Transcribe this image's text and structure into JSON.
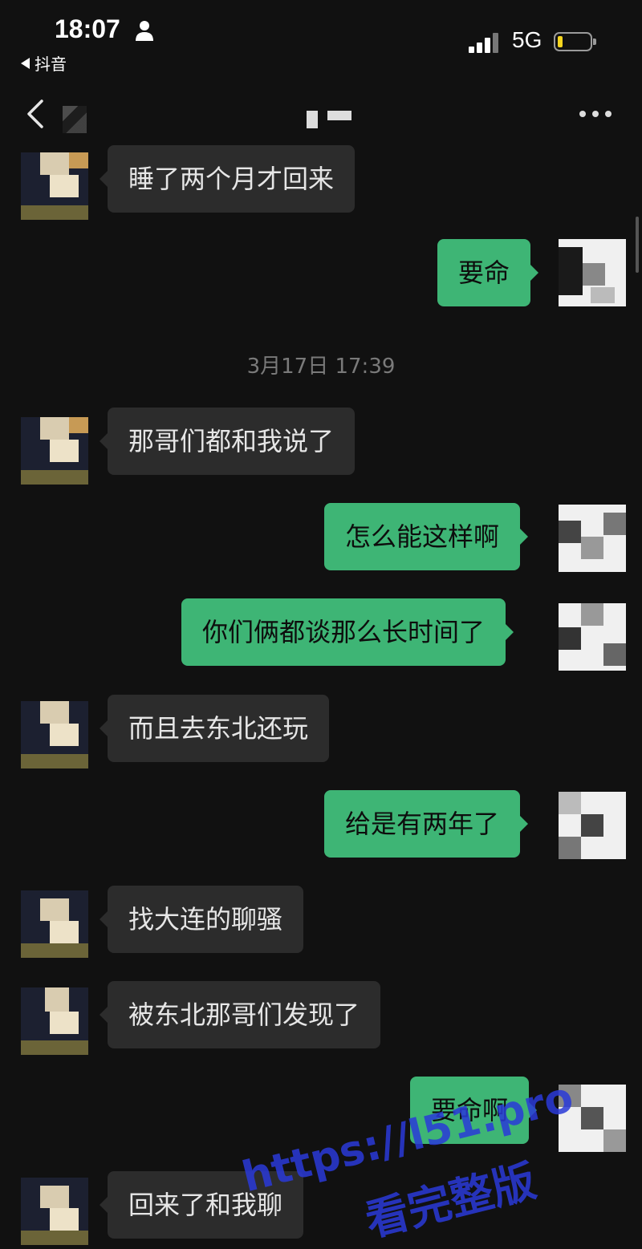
{
  "status_bar": {
    "time": "18:07",
    "back_app": "抖音",
    "network": "5G"
  },
  "chat": {
    "timestamp": "3月17日 17:39",
    "messages": [
      {
        "side": "left",
        "text": "睡了两个月才回来"
      },
      {
        "side": "right",
        "text": "要命"
      },
      {
        "side": "left",
        "text": "那哥们都和我说了"
      },
      {
        "side": "right",
        "text": "怎么能这样啊"
      },
      {
        "side": "right",
        "text": "你们俩都谈那么长时间了"
      },
      {
        "side": "left",
        "text": "而且去东北还玩"
      },
      {
        "side": "right",
        "text": "给是有两年了"
      },
      {
        "side": "left",
        "text": "找大连的聊骚"
      },
      {
        "side": "left",
        "text": "被东北那哥们发现了"
      },
      {
        "side": "right",
        "text": "要命啊"
      },
      {
        "side": "left",
        "text": "回来了和我聊"
      }
    ]
  },
  "watermark": {
    "line1": "https://l51.pro",
    "line2": "看完整版"
  },
  "colors": {
    "background": "#111111",
    "bubble_left": "#2c2c2c",
    "bubble_right": "#3eb575",
    "watermark": "#2a3ad8"
  },
  "icons": {
    "back": "chevron-left-icon",
    "more": "ellipsis-icon",
    "person": "person-icon",
    "battery": "battery-icon",
    "signal": "signal-icon"
  }
}
